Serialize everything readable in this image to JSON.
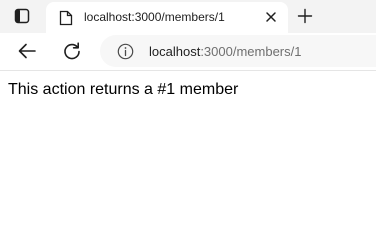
{
  "browser": {
    "tab": {
      "title": "localhost:3000/members/1",
      "icon": "page-icon"
    },
    "controls": {
      "tab_actions_icon": "tab-actions-icon",
      "close_icon": "close-icon",
      "new_tab_icon": "plus-icon",
      "back_icon": "arrow-left-icon",
      "reload_icon": "reload-icon",
      "info_icon": "info-icon"
    },
    "address_bar": {
      "host": "localhost",
      "rest": ":3000/members/1"
    }
  },
  "page": {
    "text": "This action returns a #1 member"
  },
  "colors": {
    "tabbar_bg": "#f3f3f3",
    "address_bg": "#f7f7f7",
    "url_host": "#1f1f1f",
    "url_rest": "#6f6f6f"
  }
}
